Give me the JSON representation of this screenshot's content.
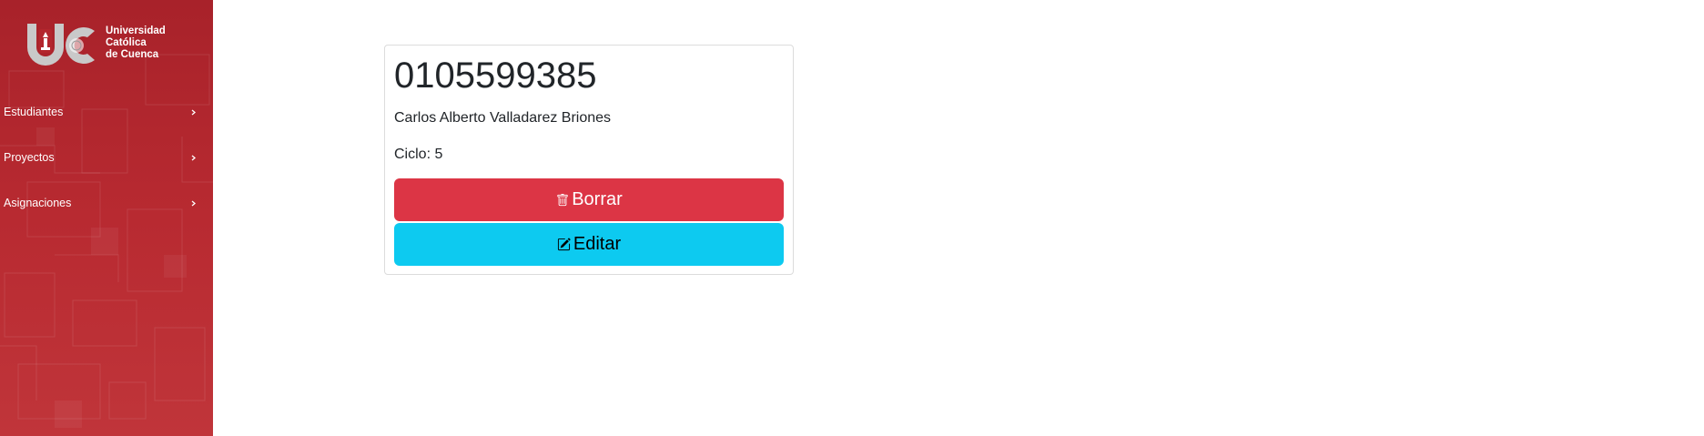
{
  "sidebar": {
    "logo": {
      "text_lines": [
        "Universidad",
        "Católica",
        "de Cuenca"
      ],
      "brand_color": "#b3262d"
    },
    "items": [
      {
        "label": "Estudiantes",
        "icon": "chevron-right-icon"
      },
      {
        "label": "Proyectos",
        "icon": "chevron-right-icon"
      },
      {
        "label": "Asignaciones",
        "icon": "chevron-right-icon"
      }
    ]
  },
  "card": {
    "title": "0105599385",
    "name": "Carlos Alberto Valladarez Briones",
    "ciclo": "Ciclo: 5",
    "delete_button": {
      "label": "Borrar",
      "icon": "trash-icon",
      "color": "#dc3545"
    },
    "edit_button": {
      "label": "Editar",
      "icon": "edit-icon",
      "color": "#0dcaf0"
    }
  }
}
